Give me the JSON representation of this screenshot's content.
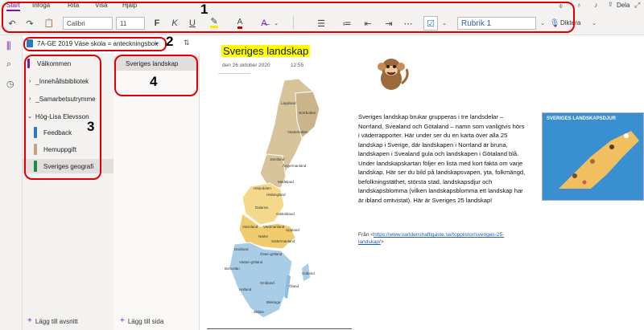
{
  "ribbon": {
    "tabs": [
      "Start",
      "Infoga",
      "Rita",
      "Visa",
      "Hjälp"
    ],
    "font_name": "Calibri",
    "font_size": "11",
    "style_name": "Rubrik 1",
    "share_label": "Dela",
    "dictate_label": "Diktera",
    "bold": "F",
    "italic": "K",
    "underline": "U"
  },
  "notebook": {
    "name": "7A-GE 2019 Väse skola = anteckningsbok"
  },
  "sections": [
    {
      "label": "Välkommen"
    },
    {
      "label": "_Innehållsbibliotek"
    },
    {
      "label": "_Samarbetsutrymme"
    },
    {
      "label": "Hög-Lisa Elevsson"
    },
    {
      "label": "Feedback",
      "color": "#2b79c2"
    },
    {
      "label": "Hemuppgift",
      "color": "#c9a27c"
    },
    {
      "label": "Sveriges geografi",
      "color": "#1e8b3a"
    }
  ],
  "pages": [
    {
      "label": "Sveriges landskap"
    }
  ],
  "add_section_label": "Lägg till avsnitt",
  "add_page_label": "Lägg till sida",
  "page": {
    "title": "Sveriges landskap",
    "date": "den 26 oktober 2020",
    "time": "12:55",
    "body": "Sveriges landskap brukar grupperas i tre landsdelar – Norrland, Svealand och Götaland – namn som vanligtvis hörs i väderrapporter. Här under ser du en karta över alla 25 landskap i Sverige, där landskapen i Norrland är bruna, landskapen i Svealand gula och landskapen i Götaland blå. Under landskapskartan följer en lista med kort fakta om varje landskap. Här ser du bild på landskapsvapen, yta, folkmängd, befolkningstäthet, största stad, landskapsdjur och landskapsblomma (vilken landskapsblomma ett landskap har är ibland omtvistat). Här är Sveriges 25 landskap!",
    "source_prefix": "Från <",
    "source_link": "https://www.varldenshaftigaste.se/topplistor/sveriges-25-landskap/",
    "source_suffix": ">",
    "poster_title": "SVERIGES LANDSKAPSDJUR"
  },
  "map_labels": [
    "Lappland",
    "Norrbotten",
    "Västerbotten",
    "Jämtland",
    "Ångermanland",
    "Härjedalen",
    "Medelpad",
    "Hälsingland",
    "Dalarna",
    "Gästrikland",
    "Uppland",
    "Värmland",
    "Västmanland",
    "Närke",
    "Södermanland",
    "Dalsland",
    "Öster-götland",
    "Väster-götland",
    "Bohuslän",
    "Småland",
    "Öland",
    "Gotland",
    "Halland",
    "Blekinge",
    "Skåne"
  ],
  "annotations": [
    "1",
    "2",
    "3",
    "4"
  ],
  "colors": {
    "accent": "#7719aa",
    "highlight": "#ffff00",
    "norrland": "#d8c49a",
    "svealand": "#f5d98a",
    "gotaland": "#a9cde6",
    "annotation": "#e00000"
  }
}
